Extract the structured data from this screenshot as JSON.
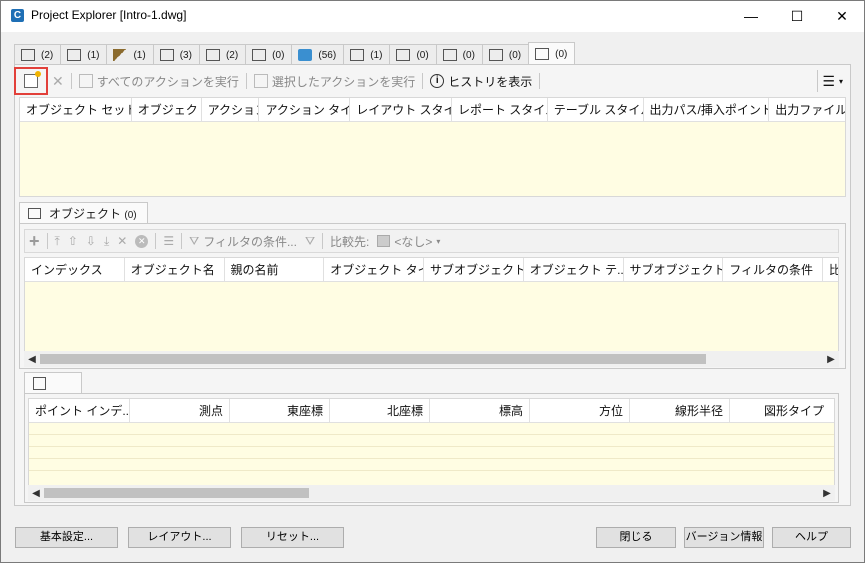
{
  "window": {
    "title": "Project Explorer [Intro-1.dwg]",
    "app_icon_letter": "C",
    "minimize": "—",
    "maximize": "☐",
    "close": "✕"
  },
  "tabs": [
    {
      "count": "(2)",
      "icon": "alignment-icon"
    },
    {
      "count": "(1)",
      "icon": "pipe-network-icon"
    },
    {
      "count": "(1)",
      "icon": "corridor-icon"
    },
    {
      "count": "(3)",
      "icon": "sample-line-icon"
    },
    {
      "count": "(2)",
      "icon": "parcel-icon"
    },
    {
      "count": "(0)",
      "icon": "feature-line-icon"
    },
    {
      "count": "(56)",
      "icon": "survey-figure-icon"
    },
    {
      "count": "(1)",
      "icon": "pressure-network-icon"
    },
    {
      "count": "(0)",
      "icon": "structure-icon"
    },
    {
      "count": "(0)",
      "icon": "profile-view-icon"
    },
    {
      "count": "(0)",
      "icon": "section-view-icon"
    },
    {
      "count": "(0)",
      "icon": "object-set-icon"
    }
  ],
  "toolbar": {
    "run_all": "すべてのアクションを実行",
    "run_selected": "選択したアクションを実行",
    "show_history": "ヒストリを表示"
  },
  "object_set_grid": {
    "columns": [
      "オブジェクト セット名",
      "オブジェクト",
      "アクション",
      "アクション タイプ",
      "レイアウト スタイル",
      "レポート スタイル",
      "テーブル スタイル",
      "出力パス/挿入ポイント",
      "出力ファイル"
    ]
  },
  "objects_tab": {
    "label": "オブジェクト",
    "count": "(0)"
  },
  "objects_toolbar": {
    "filter_conditions": "フィルタの条件...",
    "compare_label": "比較先:",
    "compare_value": "<なし>"
  },
  "objects_grid": {
    "columns": [
      "インデックス",
      "オブジェクト名",
      "親の名前",
      "オブジェクト タイプ",
      "サブオブジェクト...",
      "オブジェクト テ...",
      "サブオブジェクト...",
      "フィルタの条件",
      "比"
    ]
  },
  "points_grid": {
    "columns": [
      "ポイント インデ...",
      "測点",
      "東座標",
      "北座標",
      "標高",
      "方位",
      "線形半径",
      "図形タイプ"
    ]
  },
  "buttons": {
    "basic_settings": "基本設定...",
    "layout": "レイアウト...",
    "reset": "リセット...",
    "close": "閉じる",
    "version_info": "バージョン情報",
    "help": "ヘルプ"
  }
}
